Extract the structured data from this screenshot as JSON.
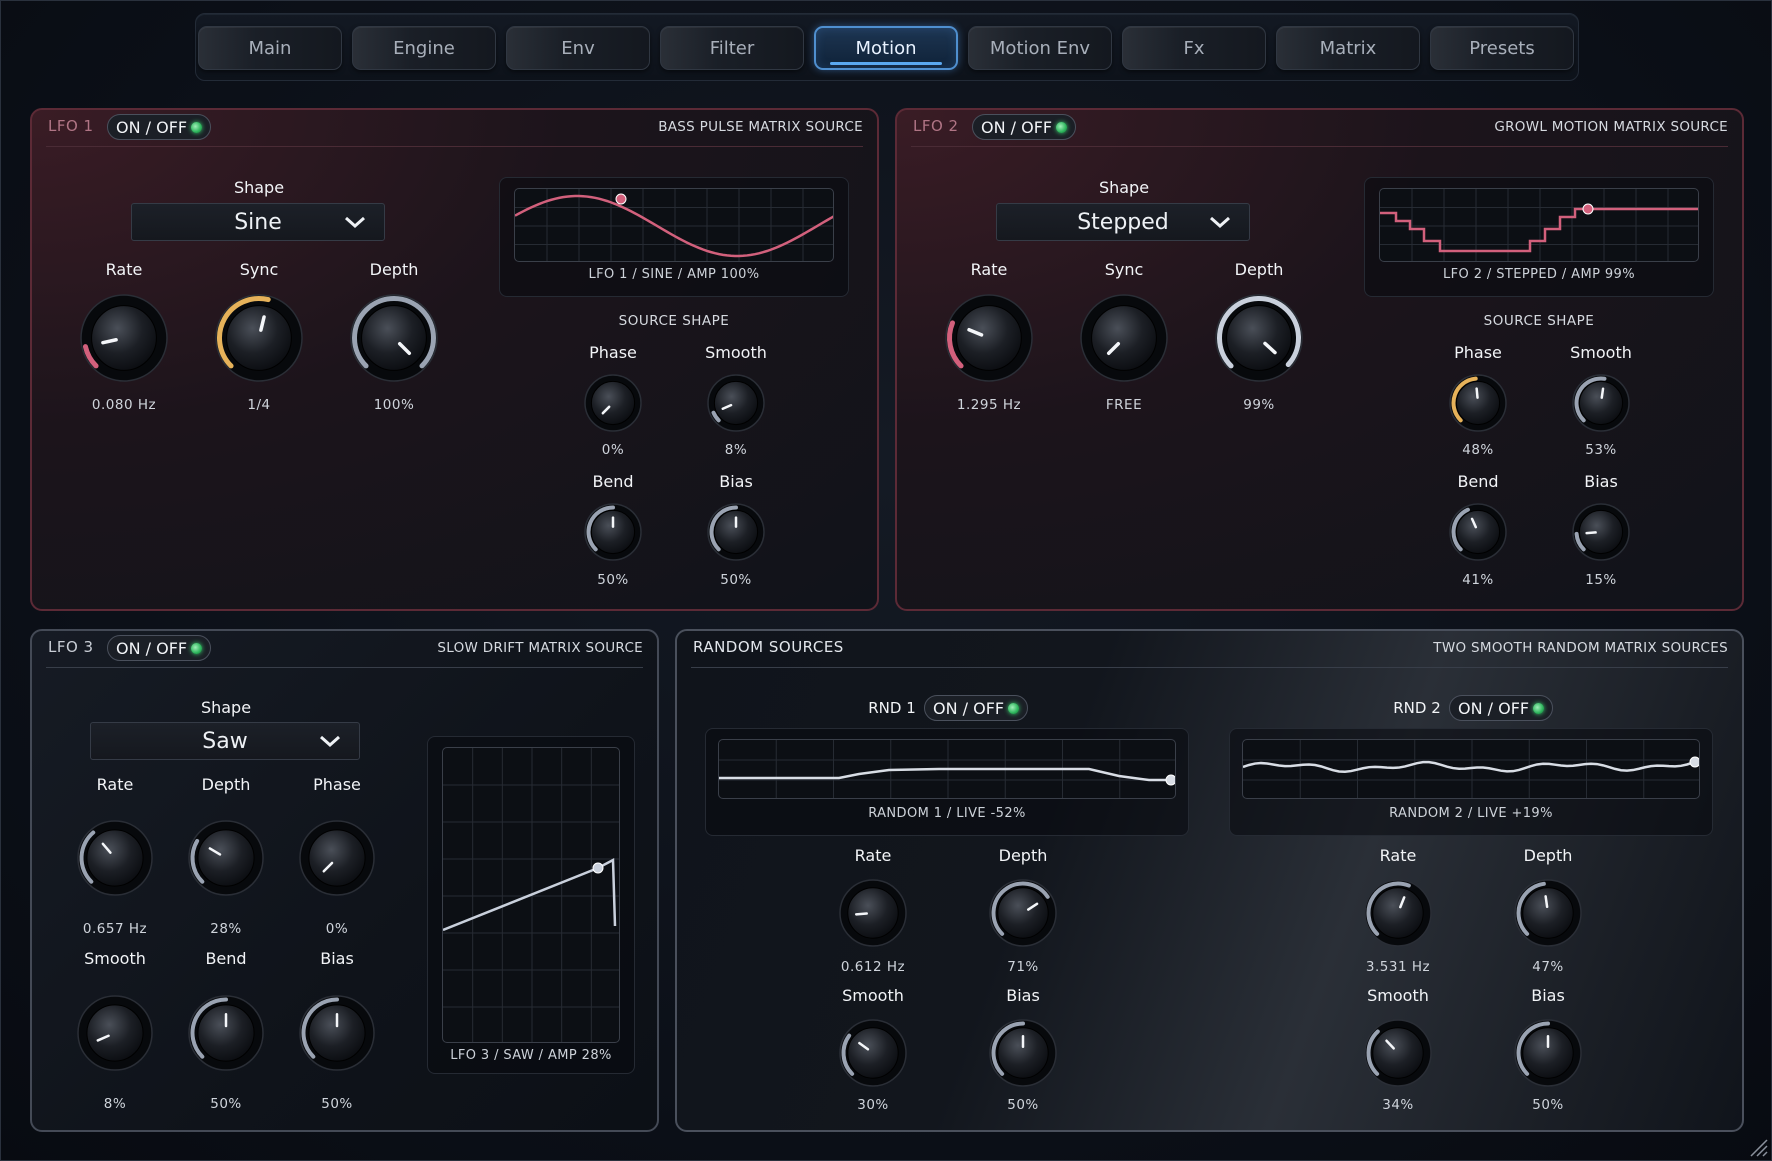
{
  "tabs": [
    {
      "label": "Main",
      "active": false
    },
    {
      "label": "Engine",
      "active": false
    },
    {
      "label": "Env",
      "active": false
    },
    {
      "label": "Filter",
      "active": false
    },
    {
      "label": "Motion",
      "active": true
    },
    {
      "label": "Motion Env",
      "active": false
    },
    {
      "label": "Fx",
      "active": false
    },
    {
      "label": "Matrix",
      "active": false
    },
    {
      "label": "Presets",
      "active": false
    }
  ],
  "colors": {
    "accent_blue": "#4f8fcf",
    "lfo_red": "#d2607c",
    "knob_gold": "#e6b25a",
    "knob_silver": "#c9d0dc",
    "led_green": "#3cd070"
  },
  "onoff_label": "ON / OFF",
  "lfo1": {
    "title": "LFO 1",
    "subtitle": "BASS PULSE MATRIX SOURCE",
    "enabled": true,
    "shape_label": "Shape",
    "shape": "Sine",
    "rate": {
      "label": "Rate",
      "value": "0.080 Hz",
      "level": 0.12,
      "color": "red"
    },
    "sync": {
      "label": "Sync",
      "value": "1/4",
      "level": 0.55,
      "color": "gold"
    },
    "depth": {
      "label": "Depth",
      "value": "100%",
      "level": 1.0,
      "color": "silver"
    },
    "scope_caption": "LFO 1 / SINE / AMP 100%",
    "source_shape_label": "SOURCE SHAPE",
    "phase": {
      "label": "Phase",
      "value": "0%",
      "level": 0.0
    },
    "smooth": {
      "label": "Smooth",
      "value": "8%",
      "level": 0.08
    },
    "bend": {
      "label": "Bend",
      "value": "50%",
      "level": 0.5
    },
    "bias": {
      "label": "Bias",
      "value": "50%",
      "level": 0.5
    }
  },
  "lfo2": {
    "title": "LFO 2",
    "subtitle": "GROWL MOTION MATRIX SOURCE",
    "enabled": true,
    "shape_label": "Shape",
    "shape": "Stepped",
    "rate": {
      "label": "Rate",
      "value": "1.295 Hz",
      "level": 0.25,
      "color": "red"
    },
    "sync": {
      "label": "Sync",
      "value": "FREE",
      "level": 0.0,
      "color": "none"
    },
    "depth": {
      "label": "Depth",
      "value": "99%",
      "level": 0.99,
      "color": "silver"
    },
    "scope_caption": "LFO 2 / STEPPED / AMP 99%",
    "source_shape_label": "SOURCE SHAPE",
    "phase": {
      "label": "Phase",
      "value": "48%",
      "level": 0.48,
      "color": "gold"
    },
    "smooth": {
      "label": "Smooth",
      "value": "53%",
      "level": 0.53
    },
    "bend": {
      "label": "Bend",
      "value": "41%",
      "level": 0.41
    },
    "bias": {
      "label": "Bias",
      "value": "15%",
      "level": 0.15
    }
  },
  "lfo3": {
    "title": "LFO 3",
    "subtitle": "SLOW DRIFT MATRIX SOURCE",
    "enabled": true,
    "shape_label": "Shape",
    "shape": "Saw",
    "rate": {
      "label": "Rate",
      "value": "0.657 Hz",
      "level": 0.35
    },
    "depth": {
      "label": "Depth",
      "value": "28%",
      "level": 0.28
    },
    "phase": {
      "label": "Phase",
      "value": "0%",
      "level": 0.0
    },
    "smooth": {
      "label": "Smooth",
      "value": "8%",
      "level": 0.08
    },
    "bend": {
      "label": "Bend",
      "value": "50%",
      "level": 0.5
    },
    "bias": {
      "label": "Bias",
      "value": "50%",
      "level": 0.5
    },
    "scope_caption": "LFO 3 / SAW / AMP 28%"
  },
  "random": {
    "title": "RANDOM SOURCES",
    "subtitle": "TWO SMOOTH RANDOM MATRIX SOURCES",
    "rnd1": {
      "title": "RND 1",
      "enabled": true,
      "scope_caption": "RANDOM 1 / LIVE -52%",
      "rate": {
        "label": "Rate",
        "value": "0.612 Hz",
        "level": 0.15
      },
      "depth": {
        "label": "Depth",
        "value": "71%",
        "level": 0.71
      },
      "smooth": {
        "label": "Smooth",
        "value": "30%",
        "level": 0.3
      },
      "bias": {
        "label": "Bias",
        "value": "50%",
        "level": 0.5
      }
    },
    "rnd2": {
      "title": "RND 2",
      "enabled": true,
      "scope_caption": "RANDOM 2 / LIVE +19%",
      "rate": {
        "label": "Rate",
        "value": "3.531 Hz",
        "level": 0.58
      },
      "depth": {
        "label": "Depth",
        "value": "47%",
        "level": 0.47
      },
      "smooth": {
        "label": "Smooth",
        "value": "34%",
        "level": 0.34
      },
      "bias": {
        "label": "Bias",
        "value": "50%",
        "level": 0.5
      }
    }
  }
}
